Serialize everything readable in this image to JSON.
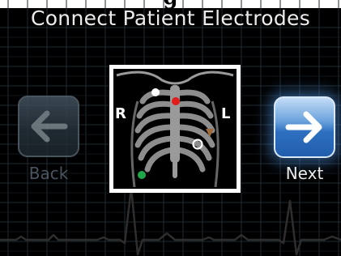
{
  "header": {
    "top_fragment": "g",
    "title": "Connect Patient Electrodes"
  },
  "navigation": {
    "back_label": "Back",
    "next_label": "Next"
  },
  "diagram": {
    "right_label": "R",
    "left_label": "L",
    "electrodes": [
      {
        "name": "right-arm",
        "color": "#ffffff",
        "style": "filled"
      },
      {
        "name": "left-arm",
        "color": "#e21b1b",
        "style": "filled"
      },
      {
        "name": "left-leg",
        "color": "#a06a3a",
        "style": "filled"
      },
      {
        "name": "chest",
        "color": "#ffffff",
        "style": "ring"
      },
      {
        "name": "right-leg",
        "color": "#1fa84a",
        "style": "filled"
      }
    ]
  },
  "colors": {
    "background": "#000000",
    "grid": "#1f2a33",
    "ribs": "#9a9a9a",
    "next_button": "#2e6fbf",
    "back_button": "#26323b"
  }
}
